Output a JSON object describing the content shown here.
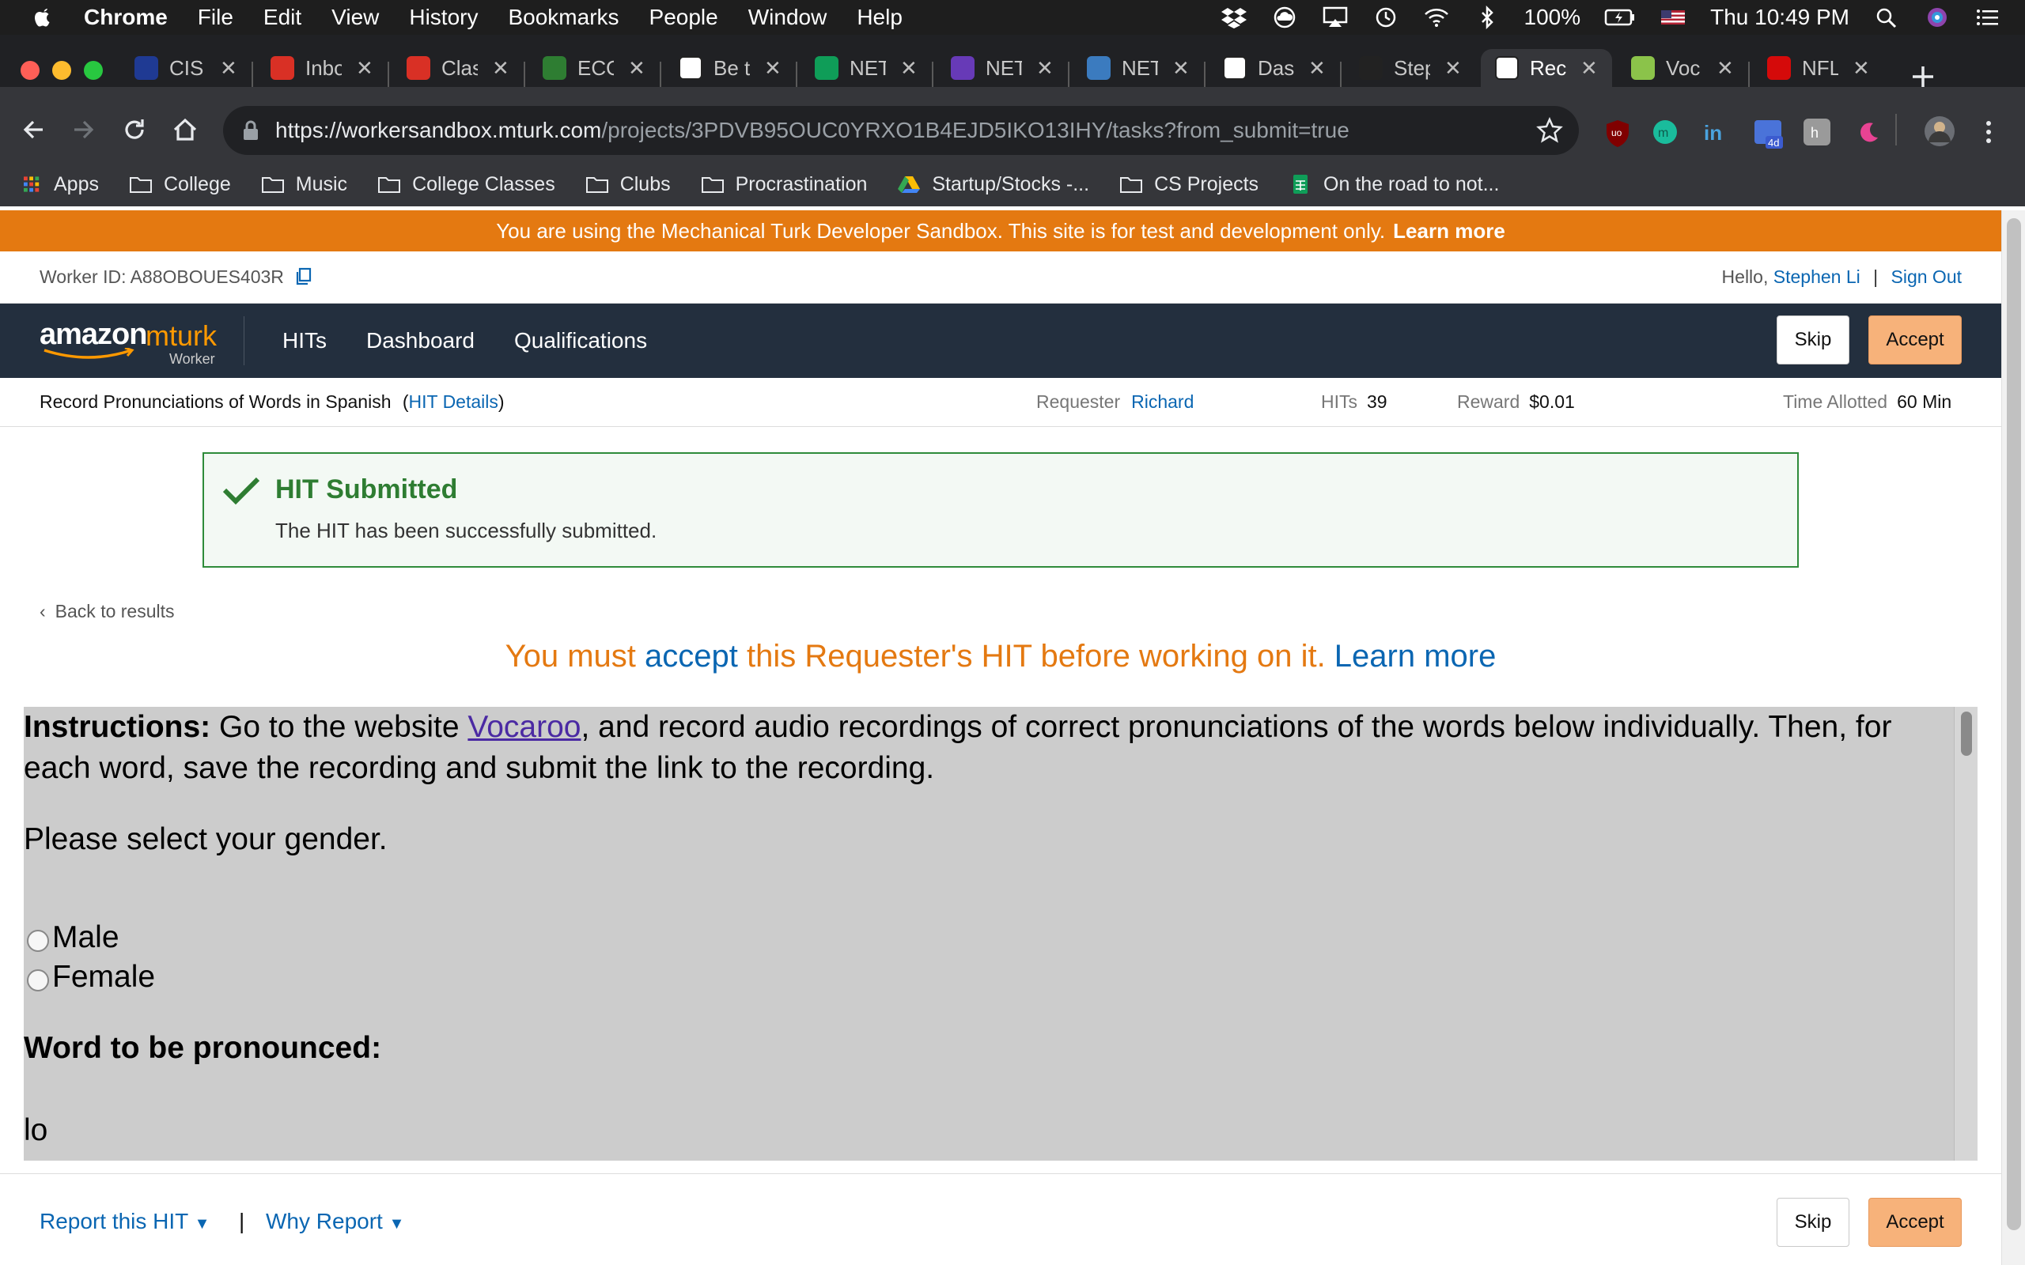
{
  "mac_menubar": {
    "app": "Chrome",
    "menus": [
      "File",
      "Edit",
      "View",
      "History",
      "Bookmarks",
      "People",
      "Window",
      "Help"
    ],
    "battery": "100%",
    "clock": "Thu 10:49 PM"
  },
  "tabs": [
    {
      "title": "CIS",
      "icon": "upenn-shield-icon",
      "color": "#1f3a93"
    },
    {
      "title": "Inbox",
      "icon": "gmail-icon",
      "color": "#d93025"
    },
    {
      "title": "Class",
      "icon": "classroom-ring-icon",
      "color": "#d93025"
    },
    {
      "title": "ECO",
      "icon": "hexagon-icon",
      "color": "#2e7d32"
    },
    {
      "title": "Be t",
      "icon": "nets-213-icon",
      "color": "#ffffff"
    },
    {
      "title": "NET",
      "icon": "google-sheets-icon",
      "color": "#0f9d58"
    },
    {
      "title": "NET",
      "icon": "google-forms-icon",
      "color": "#673ab7"
    },
    {
      "title": "NET",
      "icon": "piazza-icon",
      "color": "#3b7bbf"
    },
    {
      "title": "Das",
      "icon": "amazon-icon",
      "color": "#ffffff"
    },
    {
      "title": "Step",
      "icon": "github-icon",
      "color": "#222222"
    },
    {
      "title": "Rec",
      "icon": "amazon-icon",
      "color": "#ffffff",
      "active": true
    },
    {
      "title": "Voc",
      "icon": "vocaroo-icon",
      "color": "#8bc34a"
    },
    {
      "title": "NFL",
      "icon": "nfl-icon",
      "color": "#d50a0a"
    }
  ],
  "address": {
    "domain": "https://workersandbox.mturk.com",
    "path": "/projects/3PDVB95OUC0YRXO1B4EJD5IKO13IHY/tasks?from_submit=true"
  },
  "bookmarks": [
    "Apps",
    "College",
    "Music",
    "College Classes",
    "Clubs",
    "Procrastination",
    "Startup/Stocks -...",
    "CS Projects",
    "On the road to not..."
  ],
  "sandbox_banner": {
    "text": "You are using the Mechanical Turk Developer Sandbox. This site is for test and development only.",
    "link": "Learn more",
    "color": "#e47911"
  },
  "worker": {
    "id_label": "Worker ID: A88OBOUES403R",
    "hello": "Hello,",
    "name": "Stephen Li",
    "sep": "|",
    "sign_out": "Sign Out"
  },
  "nav": {
    "logo_amazon": "amazon",
    "logo_mturk": "mturk",
    "logo_worker": "Worker",
    "links": [
      "HITs",
      "Dashboard",
      "Qualifications"
    ],
    "skip": "Skip",
    "accept": "Accept"
  },
  "hit": {
    "title": "Record Pronunciations of Words in Spanish",
    "details_open": "(",
    "details_link": "HIT Details",
    "details_close": ")",
    "requester_label": "Requester",
    "requester": "Richard",
    "hits_label": "HITs",
    "hits": "39",
    "reward_label": "Reward",
    "reward": "$0.01",
    "time_label": "Time Allotted",
    "time": "60 Min"
  },
  "alert": {
    "heading": "HIT Submitted",
    "message": "The HIT has been successfully submitted."
  },
  "back_link": "Back to results",
  "accept_notice": {
    "pre": "You must ",
    "accept": "accept",
    "post": " this Requester's HIT before working on it. ",
    "learn": "Learn more"
  },
  "task": {
    "instr_label": "Instructions:",
    "instr_pre": " Go to the website ",
    "instr_link": "Vocaroo",
    "instr_post": ", and record audio recordings of correct pronunciations of the words below individually. Then, for each word, save the recording and submit the link to the recording.",
    "gender_q": "Please select your gender.",
    "options": [
      "Male",
      "Female"
    ],
    "word_heading": "Word to be pronounced:",
    "word": "lo"
  },
  "footer": {
    "report": "Report this HIT",
    "sep": "|",
    "why": "Why Report",
    "skip": "Skip",
    "accept": "Accept"
  }
}
